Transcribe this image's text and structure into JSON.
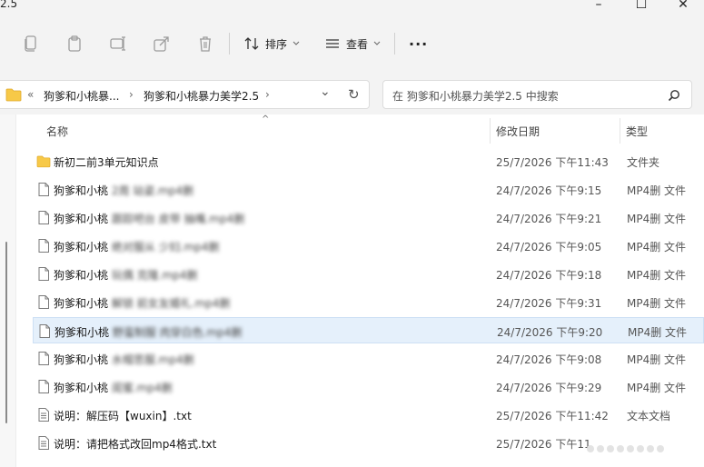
{
  "window": {
    "title_fragment": "2.5",
    "minimize": "–",
    "maximize": "☐",
    "close": "✕"
  },
  "toolbar": {
    "sort_label": "排序",
    "view_label": "查看",
    "more_label": "···"
  },
  "address": {
    "ellipsis": "«",
    "crumb1": "狗爹和小桃暴...",
    "sep1": "›",
    "crumb2": "狗爹和小桃暴力美学2.5",
    "sep2": "›",
    "dropdown": "⌄",
    "refresh": "↻"
  },
  "search": {
    "placeholder": "在 狗爹和小桃暴力美学2.5 中搜索"
  },
  "columns": {
    "name": "名称",
    "date": "修改日期",
    "type": "类型",
    "sort_indicator": "^"
  },
  "files": [
    {
      "prefix": "新初二前3单元知识点",
      "blurred": "",
      "date": "25/7/2026 下午11:43",
      "type": "文件夹",
      "kind": "folder"
    },
    {
      "prefix": "狗爹和小桃",
      "blurred": "2周 站姿.mp4删",
      "date": "24/7/2026 下午9:15",
      "type": "MP4删 文件",
      "kind": "file"
    },
    {
      "prefix": "狗爹和小桃",
      "blurred": "跟踪吧台 皮带 抽嘴.mp4删",
      "date": "24/7/2026 下午9:21",
      "type": "MP4删 文件",
      "kind": "file"
    },
    {
      "prefix": "狗爹和小桃",
      "blurred": "绝对服从 少妇.mp4删",
      "date": "24/7/2026 下午9:05",
      "type": "MP4删 文件",
      "kind": "file"
    },
    {
      "prefix": "狗爹和小桃",
      "blurred": "玩偶 克隆.mp4删",
      "date": "24/7/2026 下午9:18",
      "type": "MP4删 文件",
      "kind": "file"
    },
    {
      "prefix": "狗爹和小桃",
      "blurred": "解锁 前女友婚礼.mp4删",
      "date": "24/7/2026 下午9:31",
      "type": "MP4删 文件",
      "kind": "file"
    },
    {
      "prefix": "狗爹和小桃",
      "blurred": "野蛮制服 肉穿白色.mp4删",
      "date": "24/7/2026 下午9:20",
      "type": "MP4删 文件",
      "kind": "file"
    },
    {
      "prefix": "狗爹和小桃",
      "blurred": "水帽思服.mp4删",
      "date": "24/7/2026 下午9:08",
      "type": "MP4删 文件",
      "kind": "file"
    },
    {
      "prefix": "狗爹和小桃",
      "blurred": "闺蜜.mp4删",
      "date": "24/7/2026 下午9:29",
      "type": "MP4删 文件",
      "kind": "file"
    },
    {
      "prefix": "说明：解压码【wuxin】.txt",
      "blurred": "",
      "date": "25/7/2026 下午11:42",
      "type": "文本文档",
      "kind": "text"
    },
    {
      "prefix": "说明：请把格式改回mp4格式.txt",
      "blurred": "",
      "date": "25/7/2026 下午11",
      "type": "",
      "kind": "text"
    }
  ],
  "colors": {
    "chrome_bg": "#f3f3f3",
    "selection": "#e5f0fb",
    "folder": "#f7c948",
    "accent": "#0067c0"
  }
}
